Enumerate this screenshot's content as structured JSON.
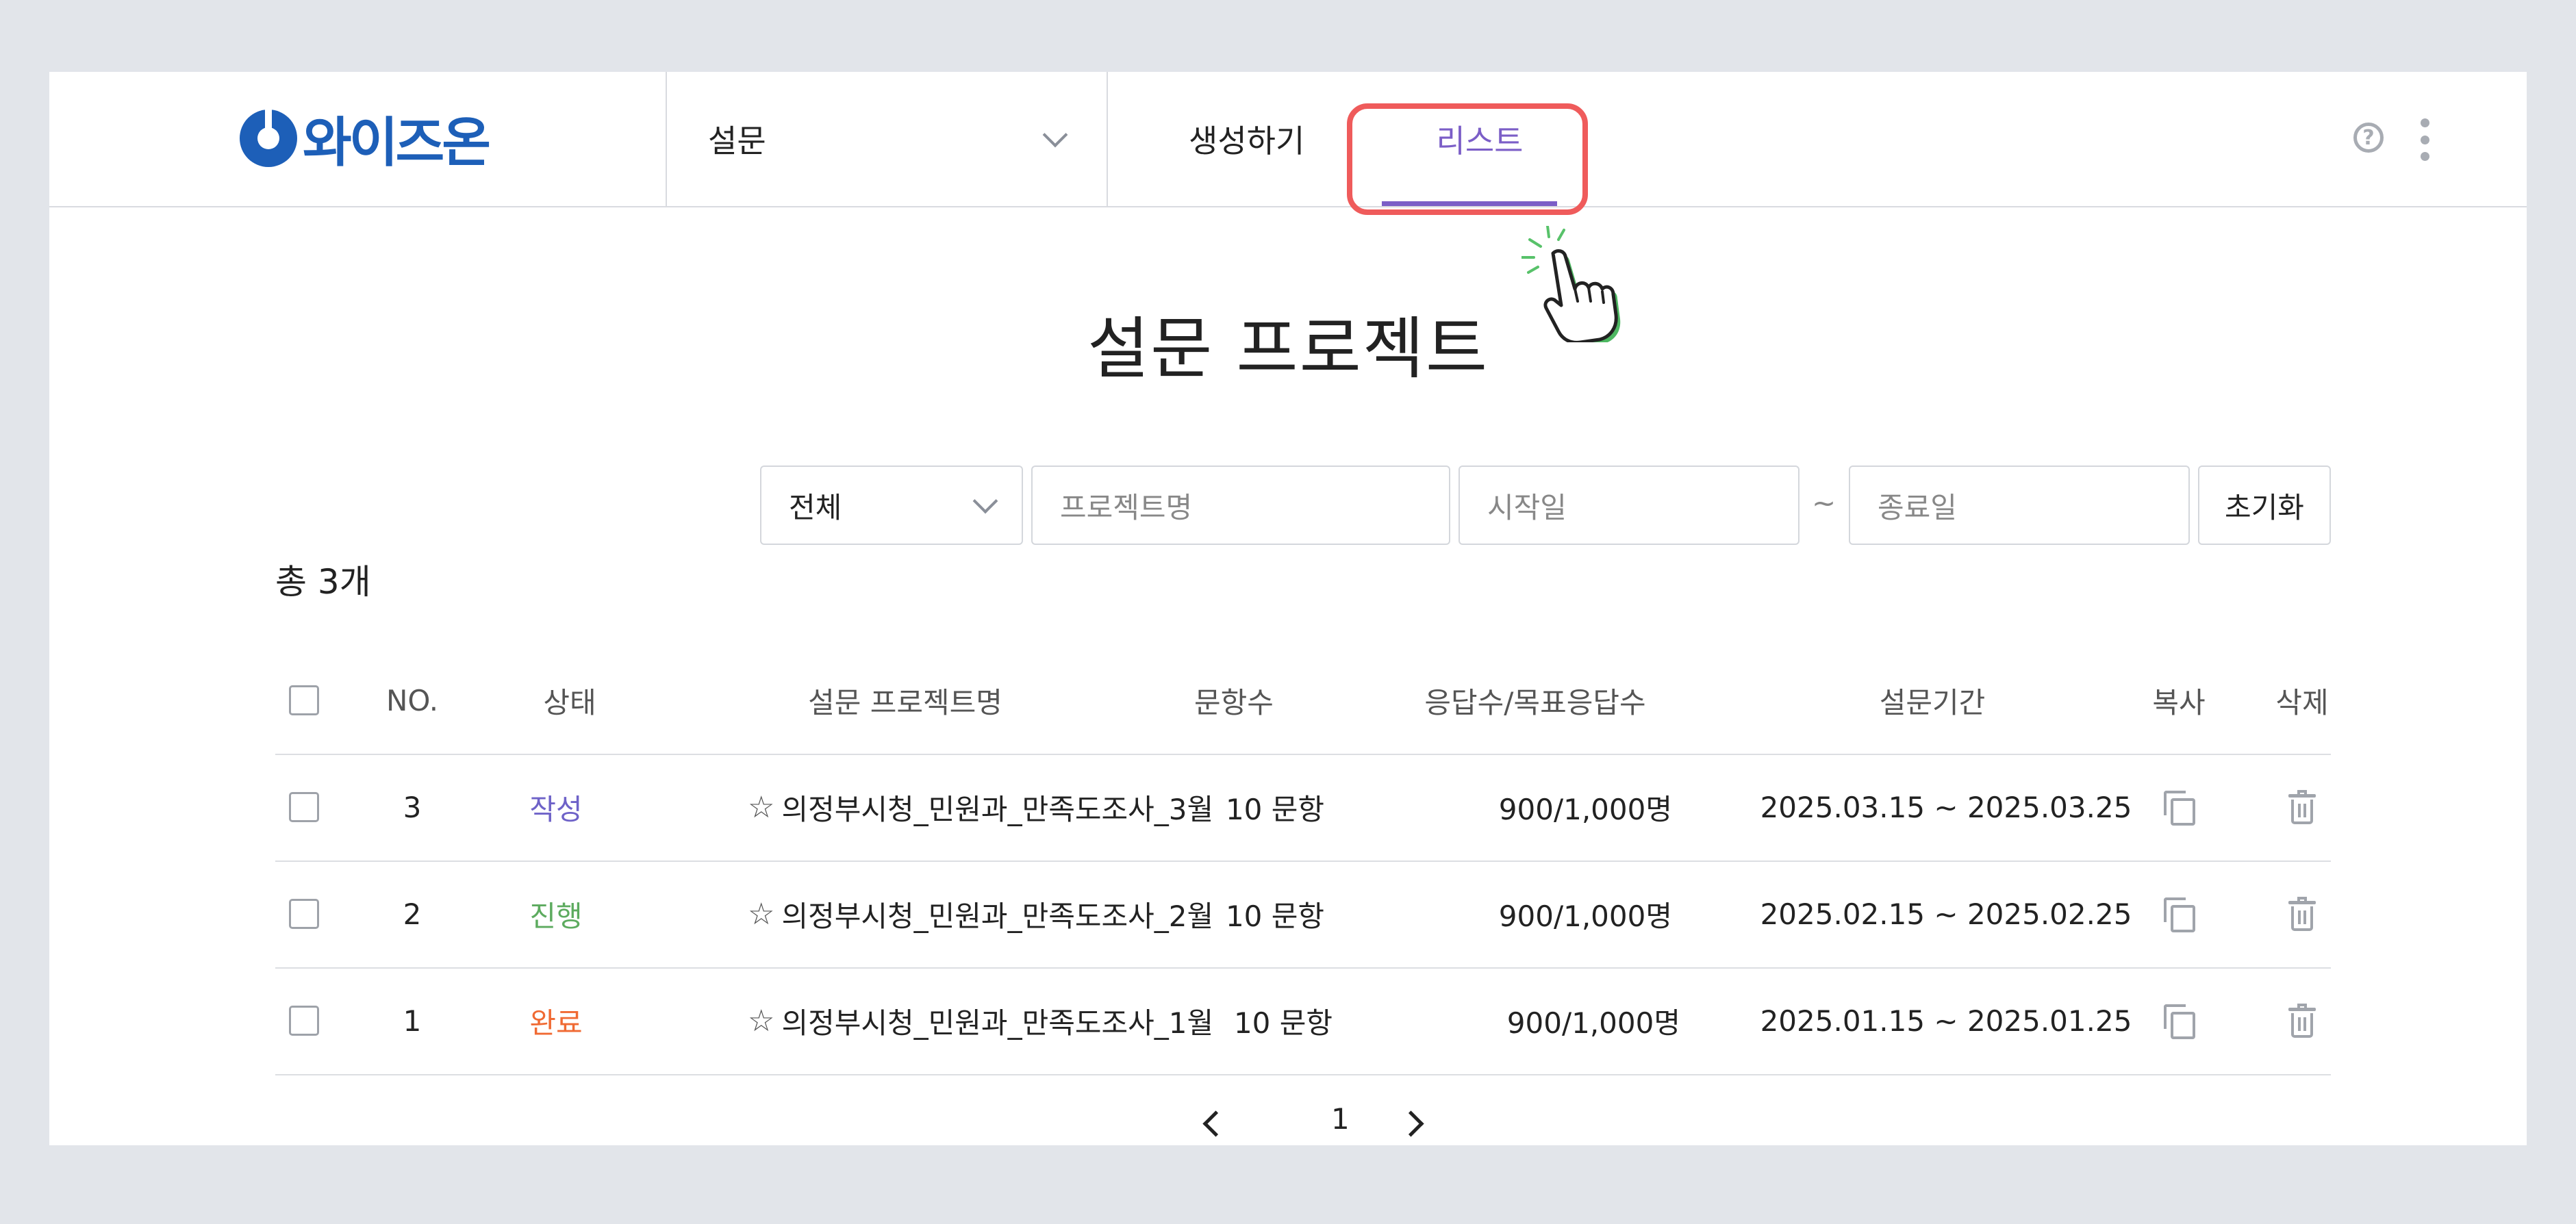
{
  "header": {
    "logo_text": "와이즈온",
    "module_select": "설문",
    "tabs": [
      {
        "label": "생성하기",
        "active": false
      },
      {
        "label": "리스트",
        "active": true
      }
    ],
    "icons": [
      "help-icon",
      "more-vertical-icon"
    ],
    "accent_color": "#7b5ec7",
    "highlight_color": "#ef5b5b"
  },
  "page": {
    "title": "설문 프로젝트",
    "total": "총 3개"
  },
  "filters": {
    "status_value": "전체",
    "project_name_placeholder": "프로젝트명",
    "start_date_placeholder": "시작일",
    "separator": "~",
    "end_date_placeholder": "종료일",
    "reset_label": "초기화"
  },
  "table": {
    "headers": {
      "no": "NO.",
      "status": "상태",
      "name": "설문 프로젝트명",
      "questions": "문항수",
      "responses": "응답수/목표응답수",
      "period": "설문기간",
      "copy": "복사",
      "delete": "삭제"
    },
    "rows": [
      {
        "no": "3",
        "status": "작성",
        "name": "의정부시청_민원과_만족도조사_3월",
        "questions": "10 문항",
        "responses": "900/1,000명",
        "period": "2025.03.15 ~ 2025.03.25"
      },
      {
        "no": "2",
        "status": "진행",
        "name": "의정부시청_민원과_만족도조사_2월",
        "questions": "10 문항",
        "responses": "900/1,000명",
        "period": "2025.02.15 ~ 2025.02.25"
      },
      {
        "no": "1",
        "status": "완료",
        "name": "의정부시청_민원과_만족도조사_1월",
        "questions": "10 문항",
        "responses": "900/1,000명",
        "period": "2025.01.15 ~ 2025.01.25"
      }
    ],
    "status_colors": {
      "작성": "#6e62c8",
      "진행": "#5dab5f",
      "완료": "#f06a33"
    }
  },
  "pagination": {
    "current": "1"
  }
}
